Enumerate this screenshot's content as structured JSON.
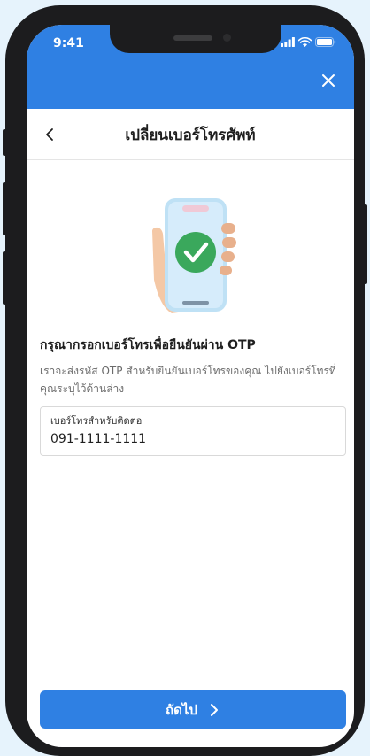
{
  "status_bar": {
    "time": "9:41"
  },
  "header": {
    "title": "เปลี่ยนเบอร์โทรศัพท์"
  },
  "content": {
    "heading": "กรุณากรอกเบอร์โทรเพื่อยืนยันผ่าน OTP",
    "description": "เราจะส่งรหัส OTP สำหรับยืนยันเบอร์โทรของคุณ ไปยังเบอร์โทรที่คุณระบุไว้ด้านล่าง"
  },
  "phone_field": {
    "label": "เบอร์โทรสำหรับติดต่อ",
    "value": "091-1111-1111"
  },
  "next_button": {
    "label": "ถัดไป"
  },
  "icons": [
    "close-icon",
    "back-chevron-icon",
    "phone-check-illustration",
    "chevron-right-icon",
    "signal-icon",
    "wifi-icon",
    "battery-icon"
  ],
  "colors": {
    "primary": "#2f80e3",
    "success": "#3aa85c",
    "background": "#e6f3fc"
  }
}
